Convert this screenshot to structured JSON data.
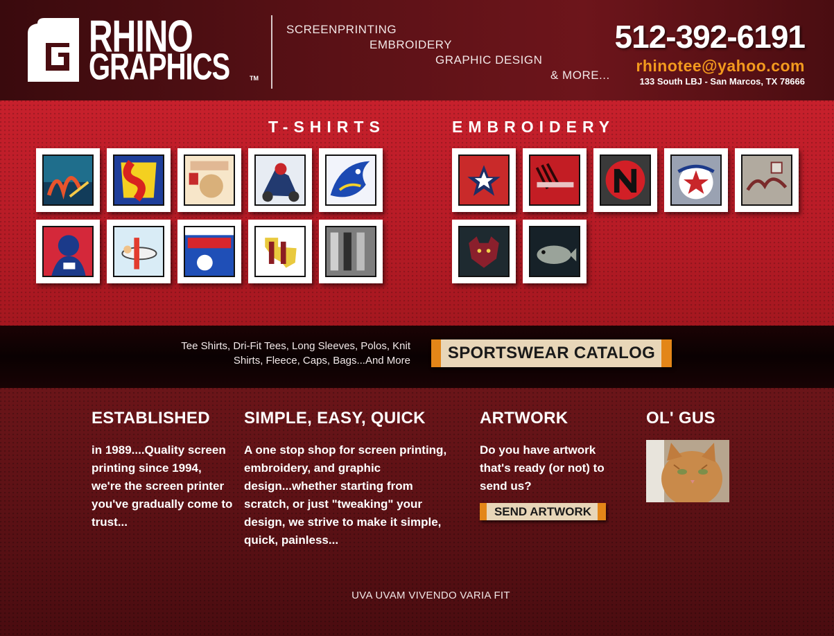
{
  "brand": {
    "line1": "RHINO",
    "line2": "GRAPHICS",
    "tm": "TM"
  },
  "services": [
    "SCREENPRINTING",
    "EMBROIDERY",
    "GRAPHIC DESIGN",
    "& MORE..."
  ],
  "contact": {
    "phone": "512-392-6191",
    "email": "rhinotee@yahoo.com",
    "address": "133 South LBJ - San Marcos, TX 78666"
  },
  "gallery": {
    "tshirts_title": "T-SHIRTS",
    "embroidery_title": "EMBROIDERY",
    "tshirts": [
      {
        "name": "aloha-delta"
      },
      {
        "name": "south-africa"
      },
      {
        "name": "operation-iraqi-freedom"
      },
      {
        "name": "motocross"
      },
      {
        "name": "marlin"
      },
      {
        "name": "football-player"
      },
      {
        "name": "airplane-cartoon"
      },
      {
        "name": "cfpo-pal-super-bowl"
      },
      {
        "name": "texas-outline"
      },
      {
        "name": "hn-photo"
      }
    ],
    "embroidery": [
      {
        "name": "texans-star"
      },
      {
        "name": "lyn-contract"
      },
      {
        "name": "red-raiders"
      },
      {
        "name": "softball"
      },
      {
        "name": "montana"
      },
      {
        "name": "bobcat"
      },
      {
        "name": "bass-fish"
      }
    ]
  },
  "strip": {
    "text": "Tee Shirts, Dri-Fit Tees, Long Sleeves, Polos, Knit Shirts, Fleece, Caps, Bags...And More",
    "catalog_button": "SPORTSWEAR CATALOG"
  },
  "columns": {
    "established": {
      "title": "ESTABLISHED",
      "body": "in 1989....Quality screen printing since 1994, we're the screen printer you've gradually come to trust..."
    },
    "simple": {
      "title": "SIMPLE, EASY, QUICK",
      "body": "A one stop shop for screen printing, embroidery, and graphic design...whether starting from scratch, or just \"tweaking\" your design, we strive to make it simple, quick, painless..."
    },
    "artwork": {
      "title": "ARTWORK",
      "body": "Do you have artwork that's ready (or not) to send us?",
      "button": "SEND ARTWORK"
    },
    "gus": {
      "title": "OL' GUS"
    }
  },
  "footer": {
    "motto": "UVA UVAM VIVENDO VARIA FIT"
  },
  "colors": {
    "accent_orange": "#f39a1e",
    "band_red": "#c7202c",
    "dark_red": "#5e1216",
    "button_cream": "#e8d6b8"
  }
}
